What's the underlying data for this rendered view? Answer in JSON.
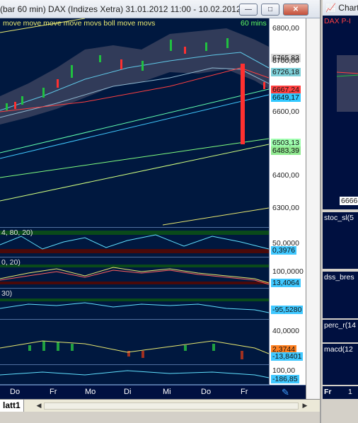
{
  "window": {
    "title": "(bar 60 min)  DAX (Indizes Xetra) 31.01.2012 11:00 - 10.02.2012 ...",
    "buttons": [
      "—",
      "□",
      "✕"
    ]
  },
  "main_chart": {
    "title": "move move move move movs boll move movs",
    "interval": "60 mins",
    "y_ticks": [
      "6800,00",
      "6700,00",
      "6600,00",
      "6400,00",
      "6300,00"
    ],
    "y_highlight": [
      {
        "text": "6765,83",
        "bg": "#d8d8d8"
      },
      {
        "text": "6726,18",
        "bg": "#7fd0d8"
      },
      {
        "text": "6667,24",
        "bg": "#ff4040"
      },
      {
        "text": "6649,17",
        "bg": "#30c8ff"
      },
      {
        "text": "6503,13",
        "bg": "#a0ffb0"
      },
      {
        "text": "6483,39",
        "bg": "#90e890"
      }
    ]
  },
  "indicators": [
    {
      "label": "4, 80, 20)",
      "y_ticks": [
        "50,0000"
      ],
      "value": "0,3976",
      "value_bg": "#40c8ff"
    },
    {
      "label": "0, 20)",
      "y_ticks": [
        "100,0000"
      ],
      "value": "13,4064",
      "value_bg": "#40c8ff"
    },
    {
      "label": "30)",
      "y_ticks": [
        ""
      ],
      "value": "-95,5280",
      "value_bg": "#40c8ff"
    },
    {
      "label": "",
      "y_ticks": [
        "40,0000"
      ],
      "value": "2,3744",
      "value_bg": "#ff8020",
      "value2": "-13,8401",
      "value2_bg": "#40c8ff"
    },
    {
      "label": "",
      "y_ticks": [
        "100,00"
      ],
      "value": "-186,85",
      "value_bg": "#40c8ff"
    }
  ],
  "x_axis": [
    "Do",
    "Fr",
    "Mo",
    "Di",
    "Mi",
    "Do",
    "Fr"
  ],
  "tabs": {
    "sheet": "latt1"
  },
  "right_panel": {
    "title": "Chart",
    "sub_title": "DAX P-I",
    "price": "6666,",
    "indicators": [
      "stoc_sl(5",
      "dss_bres",
      "perc_r(14",
      "macd(12"
    ],
    "x_label": "Fr",
    "x_label2": "1"
  }
}
